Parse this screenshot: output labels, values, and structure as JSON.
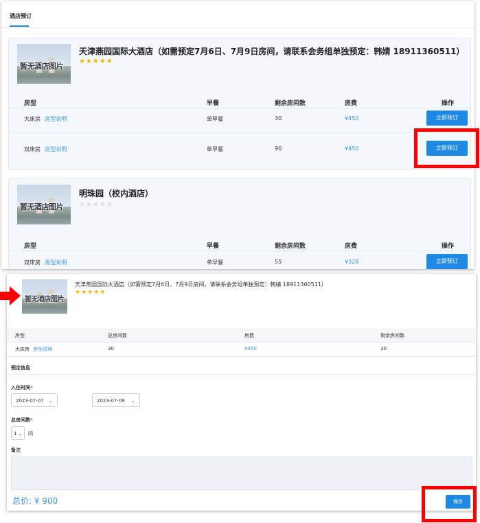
{
  "tab": {
    "label": "酒店预订"
  },
  "hotels": [
    {
      "name": "天津燕园国际大酒店（如需预定7月6日、7月9日房间，请联系会务组单独预定：韩婧 18911360511）",
      "stars": "★★★★★",
      "thumb_text": "暂无酒店图片",
      "columns": [
        "房型",
        "早餐",
        "剩余房间数",
        "房费",
        "操作"
      ],
      "rows": [
        {
          "room": "大床房",
          "link": "房型说明",
          "breakfast": "单早餐",
          "remaining": "30",
          "price": "¥450",
          "action": "立即预订"
        },
        {
          "room": "双床房",
          "link": "房型说明",
          "breakfast": "单早餐",
          "remaining": "90",
          "price": "¥450",
          "action": "立即预订"
        }
      ]
    },
    {
      "name": "明珠园（校内酒店）",
      "stars": "★★★★★",
      "thumb_text": "暂无酒店图片",
      "columns": [
        "房型",
        "早餐",
        "剩余房间数",
        "房费",
        "操作"
      ],
      "rows": [
        {
          "room": "双床房",
          "link": "房型说明",
          "breakfast": "单早餐",
          "remaining": "55",
          "price": "¥328",
          "action": "立即预订"
        }
      ]
    }
  ],
  "booking": {
    "hotel_name": "天津燕园国际大酒店（如需预定7月6日、7月9日房间，请联系会务组单独预定：韩婧 18911360511）",
    "stars": "★★★★★",
    "thumb_text": "暂无酒店图片",
    "columns": [
      "房型",
      "总房间数",
      "房费",
      "剩余房间数"
    ],
    "row": {
      "room": "大床房",
      "link": "房型说明",
      "total": "30",
      "price": "¥450",
      "remaining": "30"
    },
    "section_title": "预定信息",
    "checkin_label": "入住时间",
    "required_mark": "*",
    "checkin_date": "2023-07-07",
    "checkout_date": "2023-07-09",
    "rooms_label": "总房间数",
    "rooms_value": "1",
    "rooms_unit": "间",
    "note_label": "备注",
    "total_label": "总价: ¥ 900",
    "save_label": "保存"
  },
  "colors": {
    "accent": "#1e88e5",
    "link": "#3b96e8",
    "highlight": "#ff0000",
    "star": "#f7b500"
  }
}
